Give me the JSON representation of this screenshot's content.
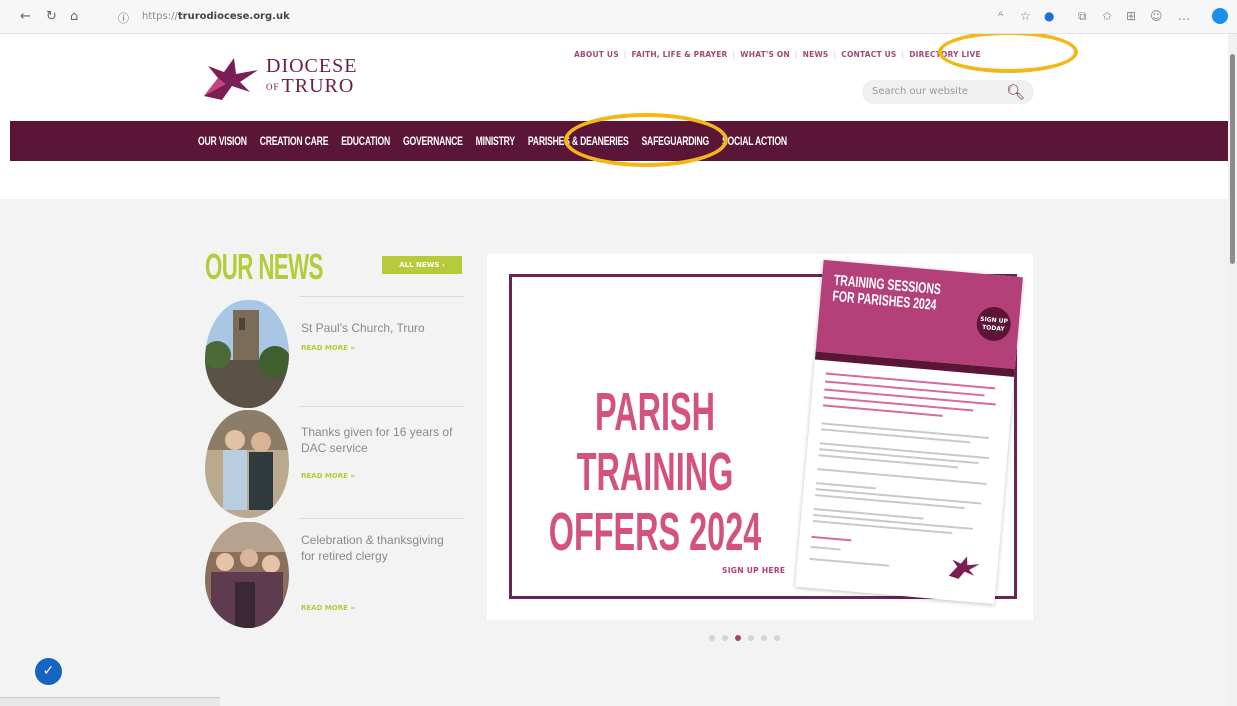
{
  "browser": {
    "url_prefix": "https://",
    "url_host": "trurodiocese.org.uk"
  },
  "header": {
    "logo_line1": "DIOCESE",
    "logo_of": "OF",
    "logo_line2": "TRURO",
    "top_links": [
      "ABOUT US",
      "FAITH, LIFE & PRAYER",
      "WHAT'S ON",
      "NEWS",
      "CONTACT US",
      "DIRECTORY LIVE"
    ],
    "search_placeholder": "Search our website"
  },
  "nav": {
    "items": [
      "OUR VISION",
      "CREATION CARE",
      "EDUCATION",
      "GOVERNANCE",
      "MINISTRY",
      "PARISHES & DEANERIES",
      "SAFEGUARDING",
      "SOCIAL ACTION"
    ]
  },
  "news": {
    "title": "OUR NEWS",
    "all_news": "ALL NEWS",
    "items": [
      {
        "headline": "St Paul's Church, Truro",
        "read_more": "READ MORE »"
      },
      {
        "headline": "Thanks given for 16 years of DAC service",
        "read_more": "READ MORE »"
      },
      {
        "headline": "Celebration & thanksgiving for retired clergy",
        "read_more": "READ MORE »"
      }
    ]
  },
  "banner": {
    "headline_line1": "PARISH TRAINING",
    "headline_line2": "OFFERS 2024",
    "sign_up": "SIGN UP HERE",
    "flyer_title": "TRAINING SESSIONS FOR PARISHES 2024",
    "flyer_badge": "SIGN UP TODAY",
    "slides_total": 6,
    "active_slide": 3
  },
  "colors": {
    "brand_plum": "#5b1537",
    "accent_green": "#b6cb3c",
    "pink": "#d4537e",
    "highlight": "#f3b817"
  }
}
